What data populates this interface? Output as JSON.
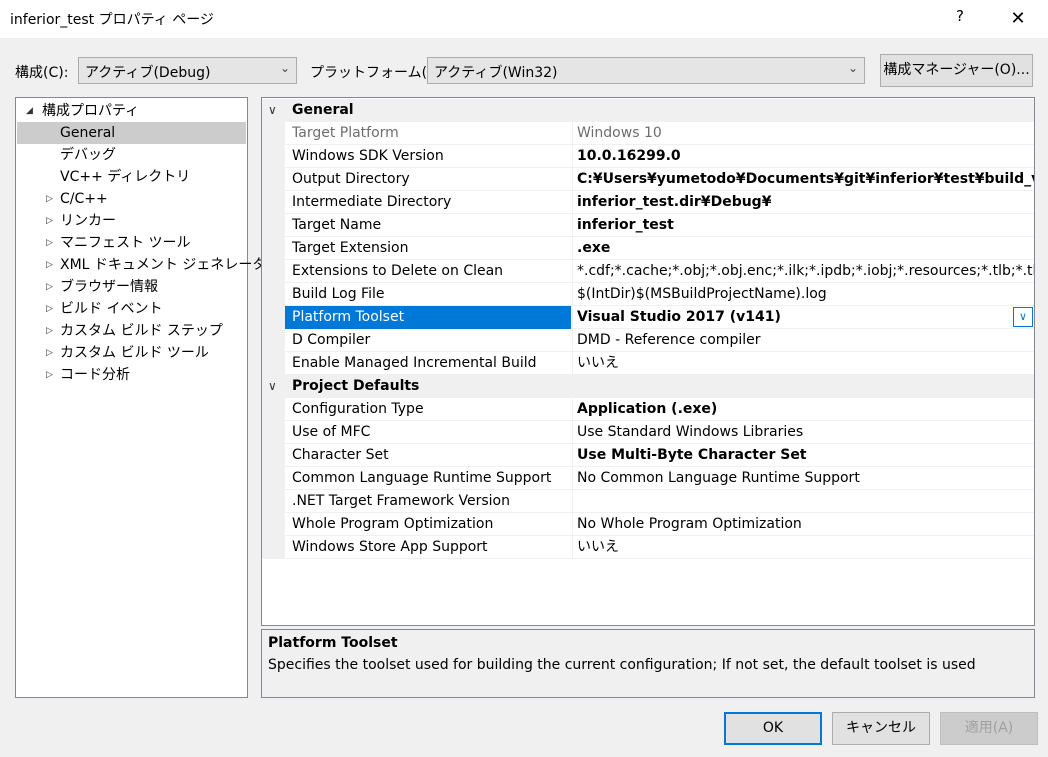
{
  "window": {
    "title": "inferior_test プロパティ ページ",
    "help_glyph": "?",
    "close_glyph": "✕"
  },
  "toolbar": {
    "config_label": "構成(C):",
    "config_value": "アクティブ(Debug)",
    "platform_label": "プラットフォーム(P):",
    "platform_value": "アクティブ(Win32)",
    "manager_button": "構成マネージャー(O)..."
  },
  "tree": {
    "root": "構成プロパティ",
    "items": [
      {
        "label": "General",
        "selected": true,
        "expandable": false
      },
      {
        "label": "デバッグ",
        "selected": false,
        "expandable": false
      },
      {
        "label": "VC++ ディレクトリ",
        "selected": false,
        "expandable": false
      },
      {
        "label": "C/C++",
        "selected": false,
        "expandable": true
      },
      {
        "label": "リンカー",
        "selected": false,
        "expandable": true
      },
      {
        "label": "マニフェスト ツール",
        "selected": false,
        "expandable": true
      },
      {
        "label": "XML ドキュメント ジェネレーター",
        "selected": false,
        "expandable": true
      },
      {
        "label": "ブラウザー情報",
        "selected": false,
        "expandable": true
      },
      {
        "label": "ビルド イベント",
        "selected": false,
        "expandable": true
      },
      {
        "label": "カスタム ビルド ステップ",
        "selected": false,
        "expandable": true
      },
      {
        "label": "カスタム ビルド ツール",
        "selected": false,
        "expandable": true
      },
      {
        "label": "コード分析",
        "selected": false,
        "expandable": true
      }
    ]
  },
  "grid": {
    "sections": [
      {
        "name": "General",
        "rows": [
          {
            "name": "Target Platform",
            "value": "Windows 10",
            "style": "dim"
          },
          {
            "name": "Windows SDK Version",
            "value": "10.0.16299.0",
            "style": "bold"
          },
          {
            "name": "Output Directory",
            "value": "C:¥Users¥yumetodo¥Documents¥git¥inferior¥test¥build_vs¥Debug¥",
            "style": "bold"
          },
          {
            "name": "Intermediate Directory",
            "value": "inferior_test.dir¥Debug¥",
            "style": "bold"
          },
          {
            "name": "Target Name",
            "value": "inferior_test",
            "style": "bold"
          },
          {
            "name": "Target Extension",
            "value": ".exe",
            "style": "bold"
          },
          {
            "name": "Extensions to Delete on Clean",
            "value": "*.cdf;*.cache;*.obj;*.obj.enc;*.ilk;*.ipdb;*.iobj;*.resources;*.tlb;*.tli;*.tlh;*.t",
            "style": "normal"
          },
          {
            "name": "Build Log File",
            "value": "$(IntDir)$(MSBuildProjectName).log",
            "style": "normal"
          },
          {
            "name": "Platform Toolset",
            "value": "Visual Studio 2017 (v141)",
            "style": "bold",
            "selected": true
          },
          {
            "name": "D Compiler",
            "value": "DMD - Reference compiler",
            "style": "normal"
          },
          {
            "name": "Enable Managed Incremental Build",
            "value": "いいえ",
            "style": "normal"
          }
        ]
      },
      {
        "name": "Project Defaults",
        "rows": [
          {
            "name": "Configuration Type",
            "value": "Application (.exe)",
            "style": "bold"
          },
          {
            "name": "Use of MFC",
            "value": "Use Standard Windows Libraries",
            "style": "normal"
          },
          {
            "name": "Character Set",
            "value": "Use Multi-Byte Character Set",
            "style": "bold"
          },
          {
            "name": "Common Language Runtime Support",
            "value": "No Common Language Runtime Support",
            "style": "normal"
          },
          {
            "name": ".NET Target Framework Version",
            "value": "",
            "style": "normal"
          },
          {
            "name": "Whole Program Optimization",
            "value": "No Whole Program Optimization",
            "style": "normal"
          },
          {
            "name": "Windows Store App Support",
            "value": "いいえ",
            "style": "normal"
          }
        ]
      }
    ]
  },
  "description": {
    "title": "Platform Toolset",
    "text": "Specifies the toolset used for building the current configuration; If not set, the default toolset is used"
  },
  "buttons": {
    "ok": "OK",
    "cancel": "キャンセル",
    "apply": "適用(A)"
  }
}
